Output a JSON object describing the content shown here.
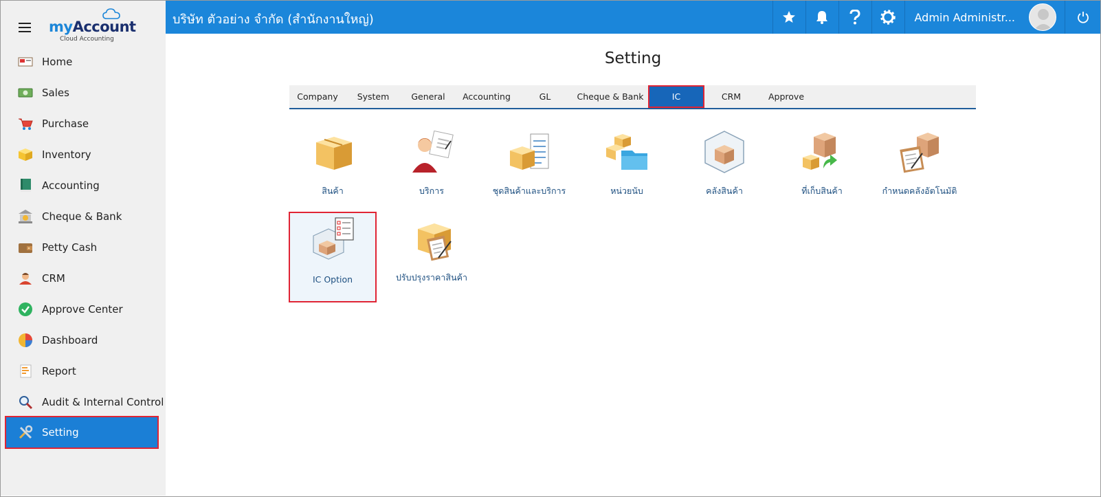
{
  "sidebar": {
    "brand_prefix": "my",
    "brand_main": "Account",
    "brand_sub": "Cloud Accounting",
    "items": [
      {
        "label": "Home",
        "icon": "home-icon"
      },
      {
        "label": "Sales",
        "icon": "money-icon"
      },
      {
        "label": "Purchase",
        "icon": "cart-icon"
      },
      {
        "label": "Inventory",
        "icon": "box-icon"
      },
      {
        "label": "Accounting",
        "icon": "book-icon"
      },
      {
        "label": "Cheque & Bank",
        "icon": "bank-icon"
      },
      {
        "label": "Petty Cash",
        "icon": "wallet-icon"
      },
      {
        "label": "CRM",
        "icon": "people-icon"
      },
      {
        "label": "Approve Center",
        "icon": "check-circle-icon"
      },
      {
        "label": "Dashboard",
        "icon": "pie-chart-icon"
      },
      {
        "label": "Report",
        "icon": "report-icon"
      },
      {
        "label": "Audit & Internal Control",
        "icon": "magnifier-icon"
      },
      {
        "label": "Setting",
        "icon": "tools-icon"
      }
    ],
    "active_item": "Setting"
  },
  "header": {
    "company": "บริษัท ตัวอย่าง จำกัด (สำนักงานใหญ่)",
    "user_name": "Admin Administr...",
    "icons": [
      "star-icon",
      "bell-icon",
      "help-icon",
      "gear-icon",
      "power-icon"
    ]
  },
  "main": {
    "title": "Setting",
    "tabs": [
      {
        "label": "Company"
      },
      {
        "label": "System"
      },
      {
        "label": "General"
      },
      {
        "label": "Accounting"
      },
      {
        "label": "GL"
      },
      {
        "label": "Cheque & Bank"
      },
      {
        "label": "IC"
      },
      {
        "label": "CRM"
      },
      {
        "label": "Approve"
      }
    ],
    "active_tab": "IC",
    "tiles": [
      {
        "label": "สินค้า",
        "icon": "product-boxes-icon"
      },
      {
        "label": "บริการ",
        "icon": "service-person-icon"
      },
      {
        "label": "ชุดสินค้าและบริการ",
        "icon": "product-set-icon"
      },
      {
        "label": "หน่วยนับ",
        "icon": "unit-folder-icon"
      },
      {
        "label": "คลังสินค้า",
        "icon": "warehouse-icon"
      },
      {
        "label": "ที่เก็บสินค้า",
        "icon": "storage-location-icon"
      },
      {
        "label": "กำหนดคลังอัตโนมัติ",
        "icon": "auto-warehouse-icon"
      },
      {
        "label": "IC Option",
        "icon": "ic-option-checklist-icon"
      },
      {
        "label": "ปรับปรุงราคาสินค้า",
        "icon": "price-adjust-icon"
      }
    ],
    "selected_tile": "IC Option"
  },
  "colors": {
    "header_blue": "#1b86da",
    "active_blue": "#1766b9",
    "highlight_red": "#e02434",
    "sidebar_bg": "#f0f0f0",
    "tile_label": "#1d4f80"
  }
}
